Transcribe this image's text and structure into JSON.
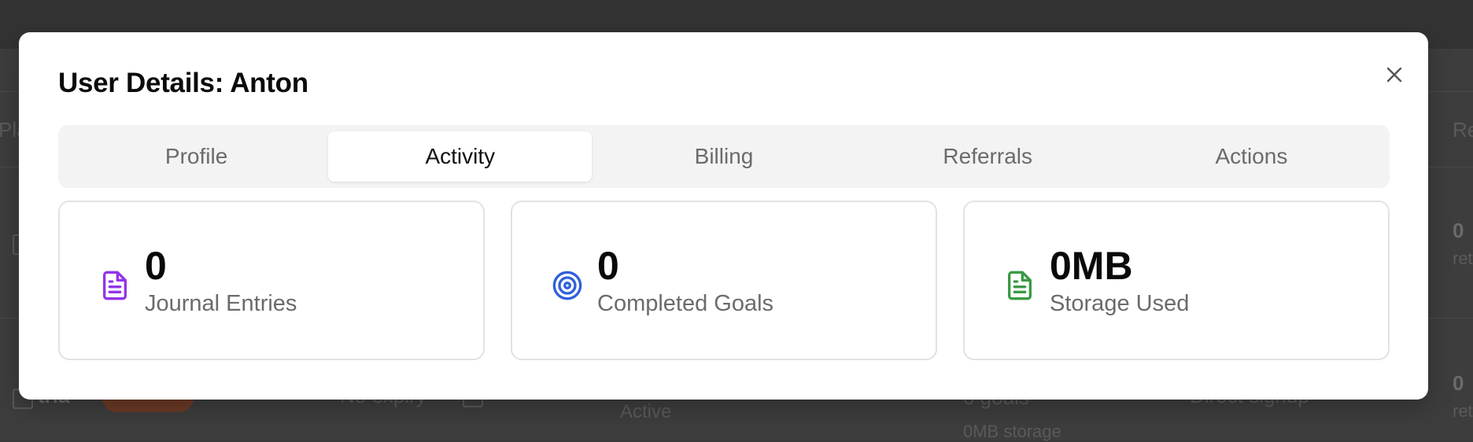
{
  "background": {
    "fragments": [
      "Pla",
      "0",
      "ret",
      "0",
      "ret",
      "tria",
      "No expiry",
      "Active",
      "0 goals",
      "0MB storage",
      "Direct signup",
      "Re"
    ]
  },
  "modal": {
    "title": "User Details: Anton",
    "close_icon": "close-icon",
    "tabs": [
      {
        "label": "Profile",
        "active": false
      },
      {
        "label": "Activity",
        "active": true
      },
      {
        "label": "Billing",
        "active": false
      },
      {
        "label": "Referrals",
        "active": false
      },
      {
        "label": "Actions",
        "active": false
      }
    ],
    "stats": [
      {
        "value": "0",
        "label": "Journal Entries",
        "icon": "document-icon",
        "color": "#9333ea"
      },
      {
        "value": "0",
        "label": "Completed Goals",
        "icon": "target-icon",
        "color": "#2f5fdc"
      },
      {
        "value": "0MB",
        "label": "Storage Used",
        "icon": "file-icon",
        "color": "#3a9a45"
      }
    ]
  }
}
